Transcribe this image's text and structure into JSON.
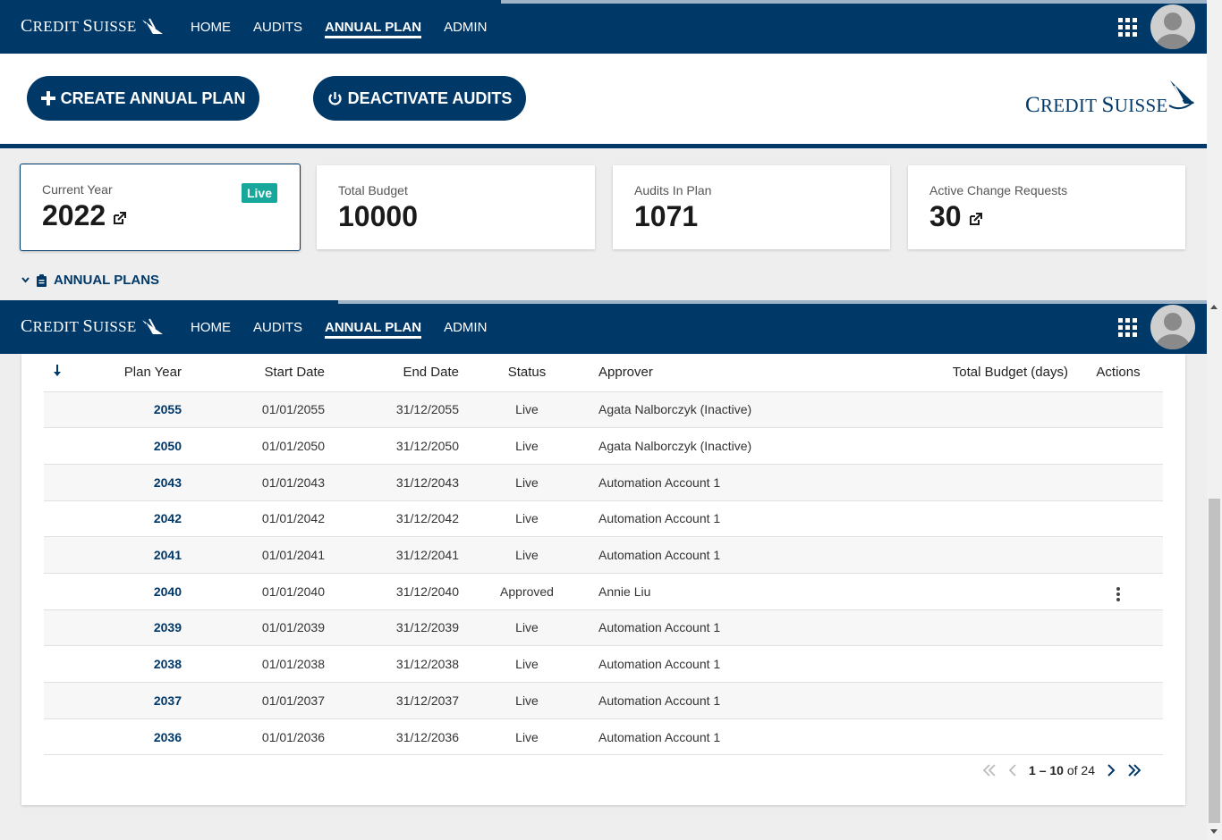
{
  "brand": {
    "cap1": "C",
    "rest1": "REDIT ",
    "cap2": "S",
    "rest2": "UISSE"
  },
  "logo": {
    "cap1": "C",
    "rest1": "REDIT ",
    "cap2": "S",
    "rest2": "UISSE"
  },
  "nav": {
    "items": [
      {
        "label": "HOME",
        "active": false
      },
      {
        "label": "AUDITS",
        "active": false
      },
      {
        "label": "ANNUAL PLAN",
        "active": true
      },
      {
        "label": "ADMIN",
        "active": false
      }
    ]
  },
  "actions": {
    "create_label": "CREATE ANNUAL PLAN",
    "deactivate_label": "DEACTIVATE AUDITS"
  },
  "cards": {
    "current_year": {
      "label": "Current Year",
      "value": "2022",
      "badge": "Live"
    },
    "total_budget": {
      "label": "Total Budget",
      "value": "10000"
    },
    "audits_in_plan": {
      "label": "Audits In Plan",
      "value": "1071"
    },
    "change_requests": {
      "label": "Active Change Requests",
      "value": "30"
    }
  },
  "section": {
    "label": "ANNUAL PLANS"
  },
  "table": {
    "headers": {
      "plan_year": "Plan Year",
      "start_date": "Start Date",
      "end_date": "End Date",
      "status": "Status",
      "approver": "Approver",
      "total_budget": "Total Budget (days)",
      "actions": "Actions"
    },
    "rows": [
      {
        "year": "2055",
        "start": "01/01/2055",
        "end": "31/12/2055",
        "status": "Live",
        "approver": "Agata Nalborczyk (Inactive)",
        "budget": ""
      },
      {
        "year": "2050",
        "start": "01/01/2050",
        "end": "31/12/2050",
        "status": "Live",
        "approver": "Agata Nalborczyk (Inactive)",
        "budget": ""
      },
      {
        "year": "2043",
        "start": "01/01/2043",
        "end": "31/12/2043",
        "status": "Live",
        "approver": "Automation Account 1",
        "budget": ""
      },
      {
        "year": "2042",
        "start": "01/01/2042",
        "end": "31/12/2042",
        "status": "Live",
        "approver": "Automation Account 1",
        "budget": ""
      },
      {
        "year": "2041",
        "start": "01/01/2041",
        "end": "31/12/2041",
        "status": "Live",
        "approver": "Automation Account 1",
        "budget": ""
      },
      {
        "year": "2040",
        "start": "01/01/2040",
        "end": "31/12/2040",
        "status": "Approved",
        "approver": "Annie Liu",
        "budget": "",
        "has_actions": true
      },
      {
        "year": "2039",
        "start": "01/01/2039",
        "end": "31/12/2039",
        "status": "Live",
        "approver": "Automation Account 1",
        "budget": ""
      },
      {
        "year": "2038",
        "start": "01/01/2038",
        "end": "31/12/2038",
        "status": "Live",
        "approver": "Automation Account 1",
        "budget": ""
      },
      {
        "year": "2037",
        "start": "01/01/2037",
        "end": "31/12/2037",
        "status": "Live",
        "approver": "Automation Account 1",
        "budget": ""
      },
      {
        "year": "2036",
        "start": "01/01/2036",
        "end": "31/12/2036",
        "status": "Live",
        "approver": "Automation Account 1",
        "budget": ""
      }
    ]
  },
  "pager": {
    "range": "1 – 10",
    "of": "of 24"
  },
  "colors": {
    "primary": "#003868",
    "live_badge": "#18a89b",
    "background": "#eeeeee"
  },
  "icons": [
    "sail-logo-icon",
    "apps-grid-icon",
    "avatar-icon",
    "plus-icon",
    "power-icon",
    "external-link-icon",
    "chevron-down-icon",
    "clipboard-icon",
    "sort-arrow-down-icon",
    "kebab-menu-icon",
    "first-page-icon",
    "prev-page-icon",
    "next-page-icon",
    "last-page-icon"
  ]
}
